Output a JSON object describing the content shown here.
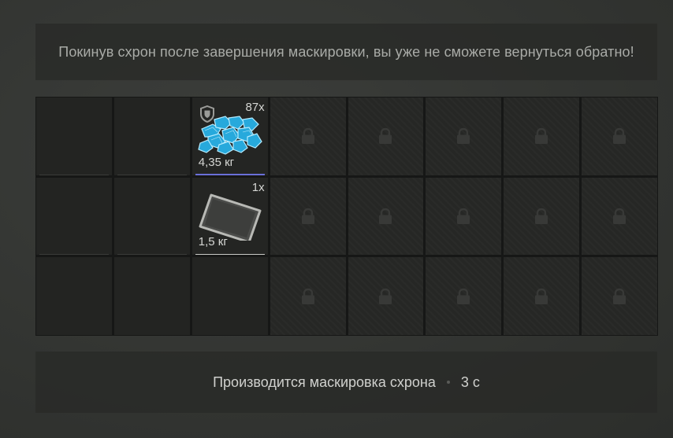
{
  "warning": {
    "text": "Покинув схрон после завершения маскировки, вы уже не сможете вернуться обратно!"
  },
  "inventory": {
    "columns": 8,
    "rows": 3,
    "open_columns": 3,
    "items": [
      {
        "name": "blue-crystals",
        "count": "87x",
        "weight": "4,35 кг",
        "icon": "shield-icon",
        "accent_color": "#6a6fd8"
      },
      {
        "name": "metal-plate",
        "count": "1x",
        "weight": "1,5 кг",
        "accent_color": "#c9cac6"
      }
    ]
  },
  "status": {
    "text": "Производится маскировка схрона",
    "timer": "3 с"
  }
}
